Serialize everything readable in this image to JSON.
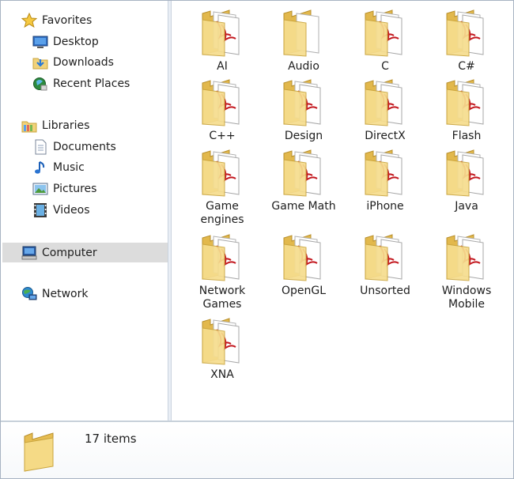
{
  "nav": {
    "favorites": {
      "label": "Favorites",
      "icon": "star-icon"
    },
    "favorite_items": [
      {
        "label": "Desktop",
        "icon": "desktop-icon"
      },
      {
        "label": "Downloads",
        "icon": "downloads-icon"
      },
      {
        "label": "Recent Places",
        "icon": "recent-places-icon"
      }
    ],
    "libraries": {
      "label": "Libraries",
      "icon": "libraries-icon"
    },
    "library_items": [
      {
        "label": "Documents",
        "icon": "documents-icon"
      },
      {
        "label": "Music",
        "icon": "music-icon"
      },
      {
        "label": "Pictures",
        "icon": "pictures-icon"
      },
      {
        "label": "Videos",
        "icon": "videos-icon"
      }
    ],
    "computer": {
      "label": "Computer",
      "icon": "computer-icon",
      "selected": true
    },
    "network": {
      "label": "Network",
      "icon": "network-icon"
    }
  },
  "folders": [
    {
      "name": "AI",
      "icon": "pdf-folder-icon"
    },
    {
      "name": "Audio",
      "icon": "folder-icon"
    },
    {
      "name": "C",
      "icon": "pdf-folder-icon"
    },
    {
      "name": "C#",
      "icon": "pdf-folder-icon"
    },
    {
      "name": "C++",
      "icon": "pdf-folder-icon"
    },
    {
      "name": "Design",
      "icon": "pdf-folder-icon"
    },
    {
      "name": "DirectX",
      "icon": "pdf-folder-icon"
    },
    {
      "name": "Flash",
      "icon": "pdf-folder-icon"
    },
    {
      "name": "Game\nengines",
      "icon": "pdf-folder-icon"
    },
    {
      "name": "Game Math",
      "icon": "pdf-folder-icon"
    },
    {
      "name": "iPhone",
      "icon": "pdf-folder-icon"
    },
    {
      "name": "Java",
      "icon": "pdf-folder-icon"
    },
    {
      "name": "Network\nGames",
      "icon": "pdf-folder-icon"
    },
    {
      "name": "OpenGL",
      "icon": "pdf-folder-icon"
    },
    {
      "name": "Unsorted",
      "icon": "pdf-folder-icon"
    },
    {
      "name": "Windows\nMobile",
      "icon": "pdf-folder-icon"
    },
    {
      "name": "XNA",
      "icon": "pdf-folder-icon"
    }
  ],
  "details": {
    "item_count": "17 items",
    "icon": "folder-icon"
  },
  "colors": {
    "folder": "#f3d77e",
    "pdf_red": "#c3181f",
    "selected": "#dcdcdc"
  }
}
